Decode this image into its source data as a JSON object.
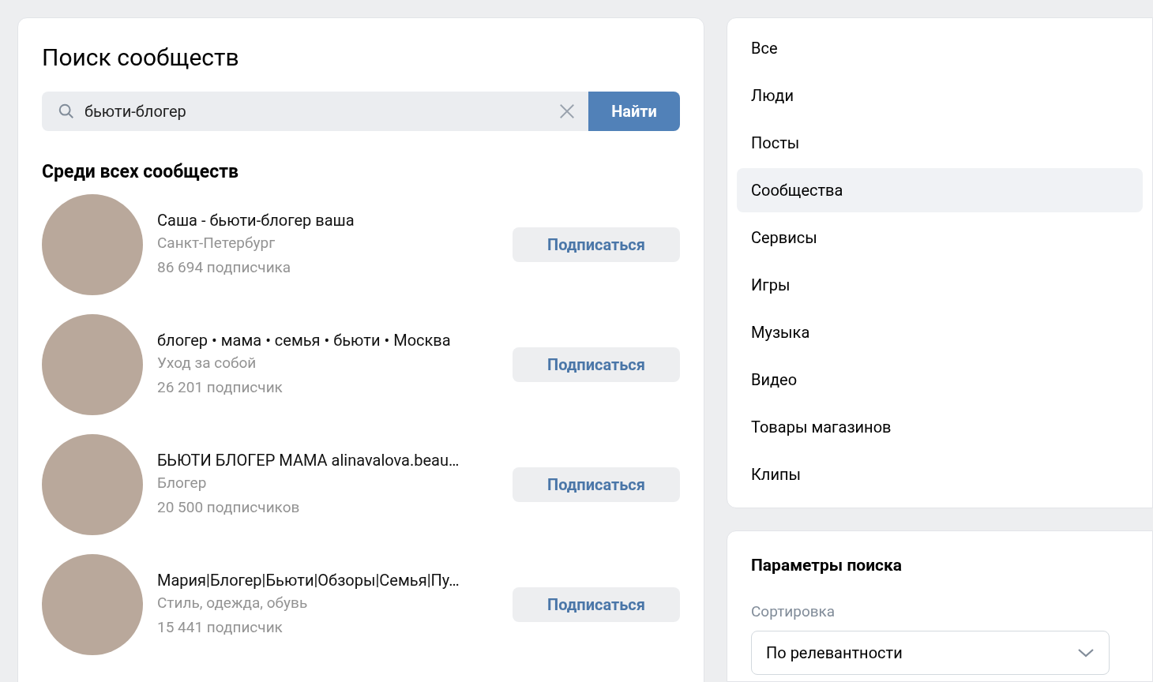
{
  "search_panel": {
    "title": "Поиск сообществ",
    "search": {
      "value": "бьюти-блогер",
      "button": "Найти"
    },
    "section_title": "Среди всех сообществ",
    "communities": [
      {
        "name": "Саша - бьюти-блогер ваша",
        "subtitle": "Санкт-Петербург",
        "followers": "86 694 подписчика",
        "button": "Подписаться"
      },
      {
        "name": "блогер • мама • семья • бьюти • Москва",
        "subtitle": "Уход за собой",
        "followers": "26 201 подписчик",
        "button": "Подписаться"
      },
      {
        "name": "БЬЮТИ БЛОГЕР МАМА alinavalova.beau…",
        "subtitle": "Блогер",
        "followers": "20 500 подписчиков",
        "button": "Подписаться"
      },
      {
        "name": "Мария|Блогер|Бьюти|Обзоры|Семья|Пу…",
        "subtitle": "Стиль, одежда, обувь",
        "followers": "15 441 подписчик",
        "button": "Подписаться"
      }
    ]
  },
  "categories": [
    {
      "label": "Все",
      "selected": false
    },
    {
      "label": "Люди",
      "selected": false
    },
    {
      "label": "Посты",
      "selected": false
    },
    {
      "label": "Сообщества",
      "selected": true
    },
    {
      "label": "Сервисы",
      "selected": false
    },
    {
      "label": "Игры",
      "selected": false
    },
    {
      "label": "Музыка",
      "selected": false
    },
    {
      "label": "Видео",
      "selected": false
    },
    {
      "label": "Товары магазинов",
      "selected": false
    },
    {
      "label": "Клипы",
      "selected": false
    }
  ],
  "search_params": {
    "title": "Параметры поиска",
    "sort_label": "Сортировка",
    "sort_value": "По релевантности"
  }
}
